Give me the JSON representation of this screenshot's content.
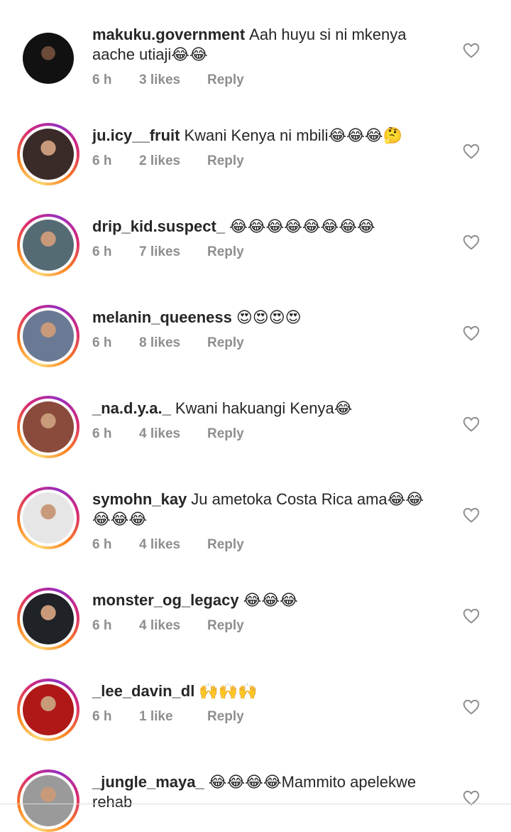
{
  "comments": [
    {
      "username": "makuku.government",
      "text": "Aah huyu si ni mkenya aache utiaji😂😂",
      "time": "6 h",
      "likes": "3 likes",
      "reply": "Reply",
      "story": false,
      "avatar_color": "#111111"
    },
    {
      "username": "ju.icy__fruit",
      "text": "Kwani Kenya ni mbili😂😂😂🤔",
      "time": "6 h",
      "likes": "2 likes",
      "reply": "Reply",
      "story": true,
      "avatar_color": "#3a2a28"
    },
    {
      "username": "drip_kid.suspect_",
      "text": "😂😂😂😂😂😂😂😂",
      "time": "6 h",
      "likes": "7 likes",
      "reply": "Reply",
      "story": true,
      "avatar_color": "#556b74"
    },
    {
      "username": "melanin_queeness",
      "text": "😍😍😍😍",
      "time": "6 h",
      "likes": "8 likes",
      "reply": "Reply",
      "story": true,
      "avatar_color": "#6a7a94"
    },
    {
      "username": "_na.d.y.a._",
      "text": "Kwani hakuangi Kenya😂",
      "time": "6 h",
      "likes": "4 likes",
      "reply": "Reply",
      "story": true,
      "avatar_color": "#8a4a3c"
    },
    {
      "username": "symohn_kay",
      "text": "Ju ametoka Costa Rica ama😂😂😂😂😂",
      "time": "6 h",
      "likes": "4 likes",
      "reply": "Reply",
      "story": true,
      "avatar_color": "#e6e6e6"
    },
    {
      "username": "monster_og_legacy",
      "text": "😂😂😂",
      "time": "6 h",
      "likes": "4 likes",
      "reply": "Reply",
      "story": true,
      "avatar_color": "#1f2328"
    },
    {
      "username": "_lee_davin_dl",
      "text": "🙌🙌🙌",
      "time": "6 h",
      "likes": "1 like",
      "reply": "Reply",
      "story": true,
      "avatar_color": "#b01818"
    },
    {
      "username": "_jungle_maya_",
      "text": "😂😂😂😂Mammito apelekwe rehab",
      "time": "",
      "likes": "",
      "reply": "",
      "story": true,
      "avatar_color": "#9a9a9a"
    }
  ],
  "icons": {
    "heart": "heart-outline-icon"
  },
  "colors": {
    "meta": "#8e8e8e",
    "username": "#262626",
    "heart": "#8e8e8e"
  }
}
